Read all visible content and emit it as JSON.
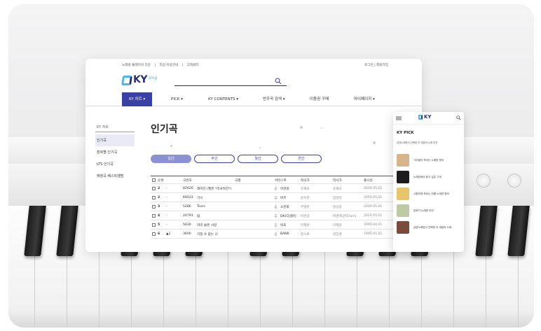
{
  "top_links": [
    "노래방 플레이어 다운",
    "|",
    "리싱 이용안내",
    "|",
    "고객센터"
  ],
  "top_links_right": "로그인 | 회원가입",
  "logo": {
    "ky": "KY",
    "sing": "sing"
  },
  "nav": [
    {
      "label": "KY 차트 ▾",
      "active": true
    },
    {
      "label": "PICK ▾",
      "active": false
    },
    {
      "label": "KY CONTENTS ▾",
      "active": false
    },
    {
      "label": "반주곡 검색 ▾",
      "active": false
    },
    {
      "label": "이용권 구매",
      "active": false
    },
    {
      "label": "마이페이지 ▾",
      "active": false
    }
  ],
  "sidebar": {
    "title": "KY 차트",
    "items": [
      {
        "label": "인기곡",
        "active": true
      },
      {
        "label": "장르별 인기곡",
        "active": false
      },
      {
        "label": "LTS 인기곡",
        "active": false
      },
      {
        "label": "애창곡 베스트앨범",
        "active": false
      }
    ]
  },
  "page_title": "인기곡",
  "period_tabs": [
    {
      "label": "일간",
      "active": true
    },
    {
      "label": "주간",
      "active": false
    },
    {
      "label": "월간",
      "active": false
    },
    {
      "label": "연간",
      "active": false
    }
  ],
  "table": {
    "headers": [
      "순위",
      "곡번호",
      "곡명",
      "아티스트",
      "작곡가",
      "작사가",
      "출시일"
    ],
    "rows": [
      {
        "rank": "2",
        "change": "-",
        "no": "82626",
        "title": "헤어진 (멜론 *리셔워진*)",
        "artist": "이찬원",
        "composer": "유재호",
        "lyricist": "유재호",
        "date": "2024.05.01"
      },
      {
        "rank": "2",
        "change": "-",
        "no": "69033",
        "title": "가시",
        "artist": "버즈",
        "composer": "윤우현",
        "lyricist": "임성익",
        "date": "2005.05.01"
      },
      {
        "rank": "3",
        "change": "-",
        "no": "5286",
        "title": "Tears",
        "artist": "소찬휘",
        "composer": "주영훈",
        "lyricist": "정상용",
        "date": "2000.05.01"
      },
      {
        "rank": "4",
        "change": "-",
        "no": "24793",
        "title": "밤",
        "artist": "DK(디셈버)",
        "composer": "이관섭",
        "lyricist": "박경애,안다(am)",
        "date": "2022.05.01"
      },
      {
        "rank": "5",
        "change": "-",
        "no": "5630",
        "title": "미미 슬픈 사랑",
        "artist": "박효",
        "composer": "이재원",
        "lyricist": "이재원",
        "date": "1995.04.01"
      },
      {
        "rank": "6",
        "change": "▲1",
        "no": "3690",
        "title": "가질 수 없는 너",
        "artist": "BANK",
        "composer": "정시로",
        "lyricist": "김민경",
        "date": "1995.01.01"
      }
    ]
  },
  "phone": {
    "logo": "KY",
    "pick_title": "KY PICK",
    "pick_sub": "금영노래방이 선택한 이 계절의 노래 추천",
    "items": [
      {
        "text": "그리움이 보이는 노래방 명곡",
        "color": "#d7b48c"
      },
      {
        "text": "노래방에서 듣고 싶은 그곡",
        "color": "#1c1c1c"
      },
      {
        "text": "시원하게 부르는 여름 노래방 명곡",
        "color": "#e8c46a"
      },
      {
        "text": "분위기 노래방 추천",
        "color": "#bfc9a5"
      },
      {
        "text": "금영노래방이 선택한 이 계절의 노래",
        "color": "#7a4a3a"
      }
    ]
  },
  "colors": {
    "accent": "#3b40a4",
    "tab_active": "#8c91d3",
    "logo_light": "#4bb6e8"
  }
}
